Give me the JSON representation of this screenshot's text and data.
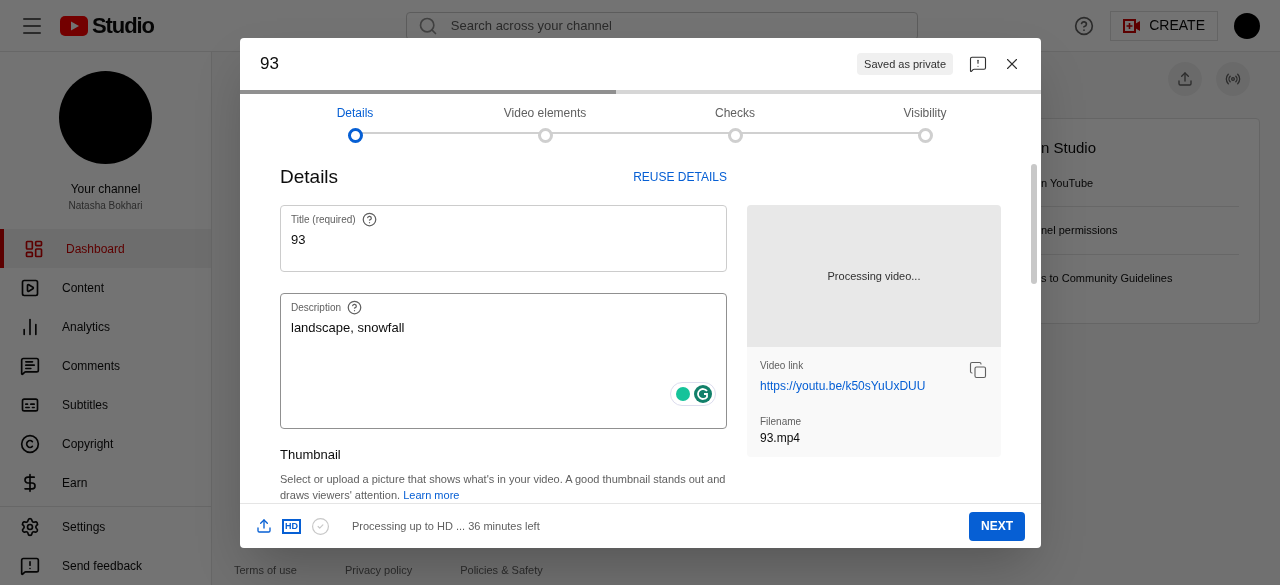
{
  "header": {
    "logo": "Studio",
    "search": {
      "placeholder": "Search across your channel"
    },
    "create_button": "CREATE"
  },
  "channel": {
    "title": "Your channel",
    "name": "Natasha Bokhari"
  },
  "sidebar": {
    "items": [
      {
        "label": "Dashboard",
        "selected": true
      },
      {
        "label": "Content",
        "selected": false
      },
      {
        "label": "Analytics",
        "selected": false
      },
      {
        "label": "Comments",
        "selected": false
      },
      {
        "label": "Subtitles",
        "selected": false
      },
      {
        "label": "Copyright",
        "selected": false
      },
      {
        "label": "Earn",
        "selected": false
      }
    ],
    "bottom_items": [
      "Settings",
      "Send feedback"
    ]
  },
  "background_card": {
    "title": "n Studio",
    "items": [
      "n YouTube",
      "nel permissions",
      "s to Community Guidelines"
    ]
  },
  "footer_links": [
    "Terms of use",
    "Privacy policy",
    "Policies & Safety"
  ],
  "dialog": {
    "title": "93",
    "status_badge": "Saved as private",
    "upload_progress": {
      "level": 0.47
    },
    "steps": [
      {
        "label": "Details",
        "selected": true
      },
      {
        "label": "Video elements",
        "selected": false
      },
      {
        "label": "Checks",
        "selected": false
      },
      {
        "label": "Visibility",
        "selected": false
      }
    ],
    "section_title": "Details",
    "reuse_button": "REUSE DETAILS",
    "title_field": {
      "label": "Title (required)",
      "value": "93"
    },
    "description_field": {
      "label": "Description",
      "value": "landscape, snowfall"
    },
    "thumbnail": {
      "heading": "Thumbnail",
      "text": "Select or upload a picture that shows what's in your video. A good thumbnail stands out and draws viewers' attention.",
      "link": "Learn more"
    },
    "preview": {
      "text": "Processing video..."
    },
    "video_link": {
      "label": "Video link",
      "value": "https://youtu.be/k50sYuUxDUU"
    },
    "filename": {
      "label": "Filename",
      "value": "93.mp4"
    },
    "footer": {
      "hd_badge": "HD",
      "status": "Processing up to HD ... 36 minutes left",
      "next_button": "NEXT"
    }
  }
}
